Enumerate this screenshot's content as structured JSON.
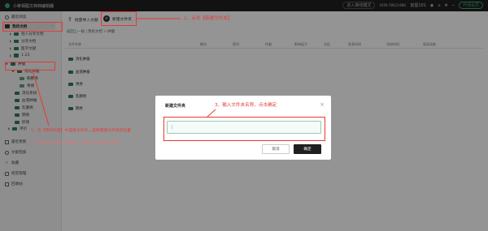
{
  "app": {
    "title": "小移相图文档档编辑器",
    "right_pill": "进入离线模式",
    "storage": "1059.78G/3.98G",
    "user": "前屋101",
    "vip_button": "开通会员"
  },
  "sidebar": {
    "items": [
      {
        "label": "最近阅读"
      },
      {
        "label": "我的文档"
      },
      {
        "label": "他人分享文档"
      },
      {
        "label": "分享文档"
      },
      {
        "label": "医学文献"
      },
      {
        "label": "1.23"
      },
      {
        "label": "肿瘤"
      },
      {
        "label": "消化肿瘤"
      },
      {
        "label": "胸肺癌"
      },
      {
        "label": "胃癌"
      },
      {
        "label": "消化系统"
      },
      {
        "label": "血液肿瘤"
      },
      {
        "label": "乳腺癌"
      },
      {
        "label": "肺癌"
      },
      {
        "label": "肝病"
      },
      {
        "label": "评价"
      },
      {
        "label": "最近更新"
      },
      {
        "label": "文献检索"
      },
      {
        "label": "收藏"
      },
      {
        "label": "标签管理"
      },
      {
        "label": "回收站"
      }
    ]
  },
  "toolbar": {
    "import_label": "批量导入文献",
    "new_folder_label": "新建文件夹"
  },
  "breadcrumb": {
    "back": "返回上一级",
    "path": "我的文档 > 肿瘤"
  },
  "table": {
    "headers": [
      "文件名称",
      "期次",
      "国刊",
      "作者",
      "影响因子",
      "分区",
      "发表时间",
      "添加时间",
      "阅读进度"
    ],
    "rows": [
      {
        "name": "消化肿瘤"
      },
      {
        "name": "血液肿瘤"
      },
      {
        "name": "胃癌"
      },
      {
        "name": "乳腺癌"
      },
      {
        "name": "肺癌"
      }
    ]
  },
  "dialog": {
    "title": "新建文件夹",
    "input_value": "|",
    "cancel_label": "取消",
    "ok_label": "确定"
  },
  "annotations": {
    "step1": "1、在【我的文献】中选择文件夹，选择需建文件夹的位置",
    "step1_sub": "注：在右侧文件夹列表点击新建即可，可选择在文件夹内新建（如图）",
    "step2": "2、点击【新建文件夹】",
    "step3": "3、输入文件夹名称，点击确定"
  },
  "colors": {
    "accent": "#2e7d5b",
    "annotation": "#e53935",
    "titlebar": "#1f1f1f"
  }
}
